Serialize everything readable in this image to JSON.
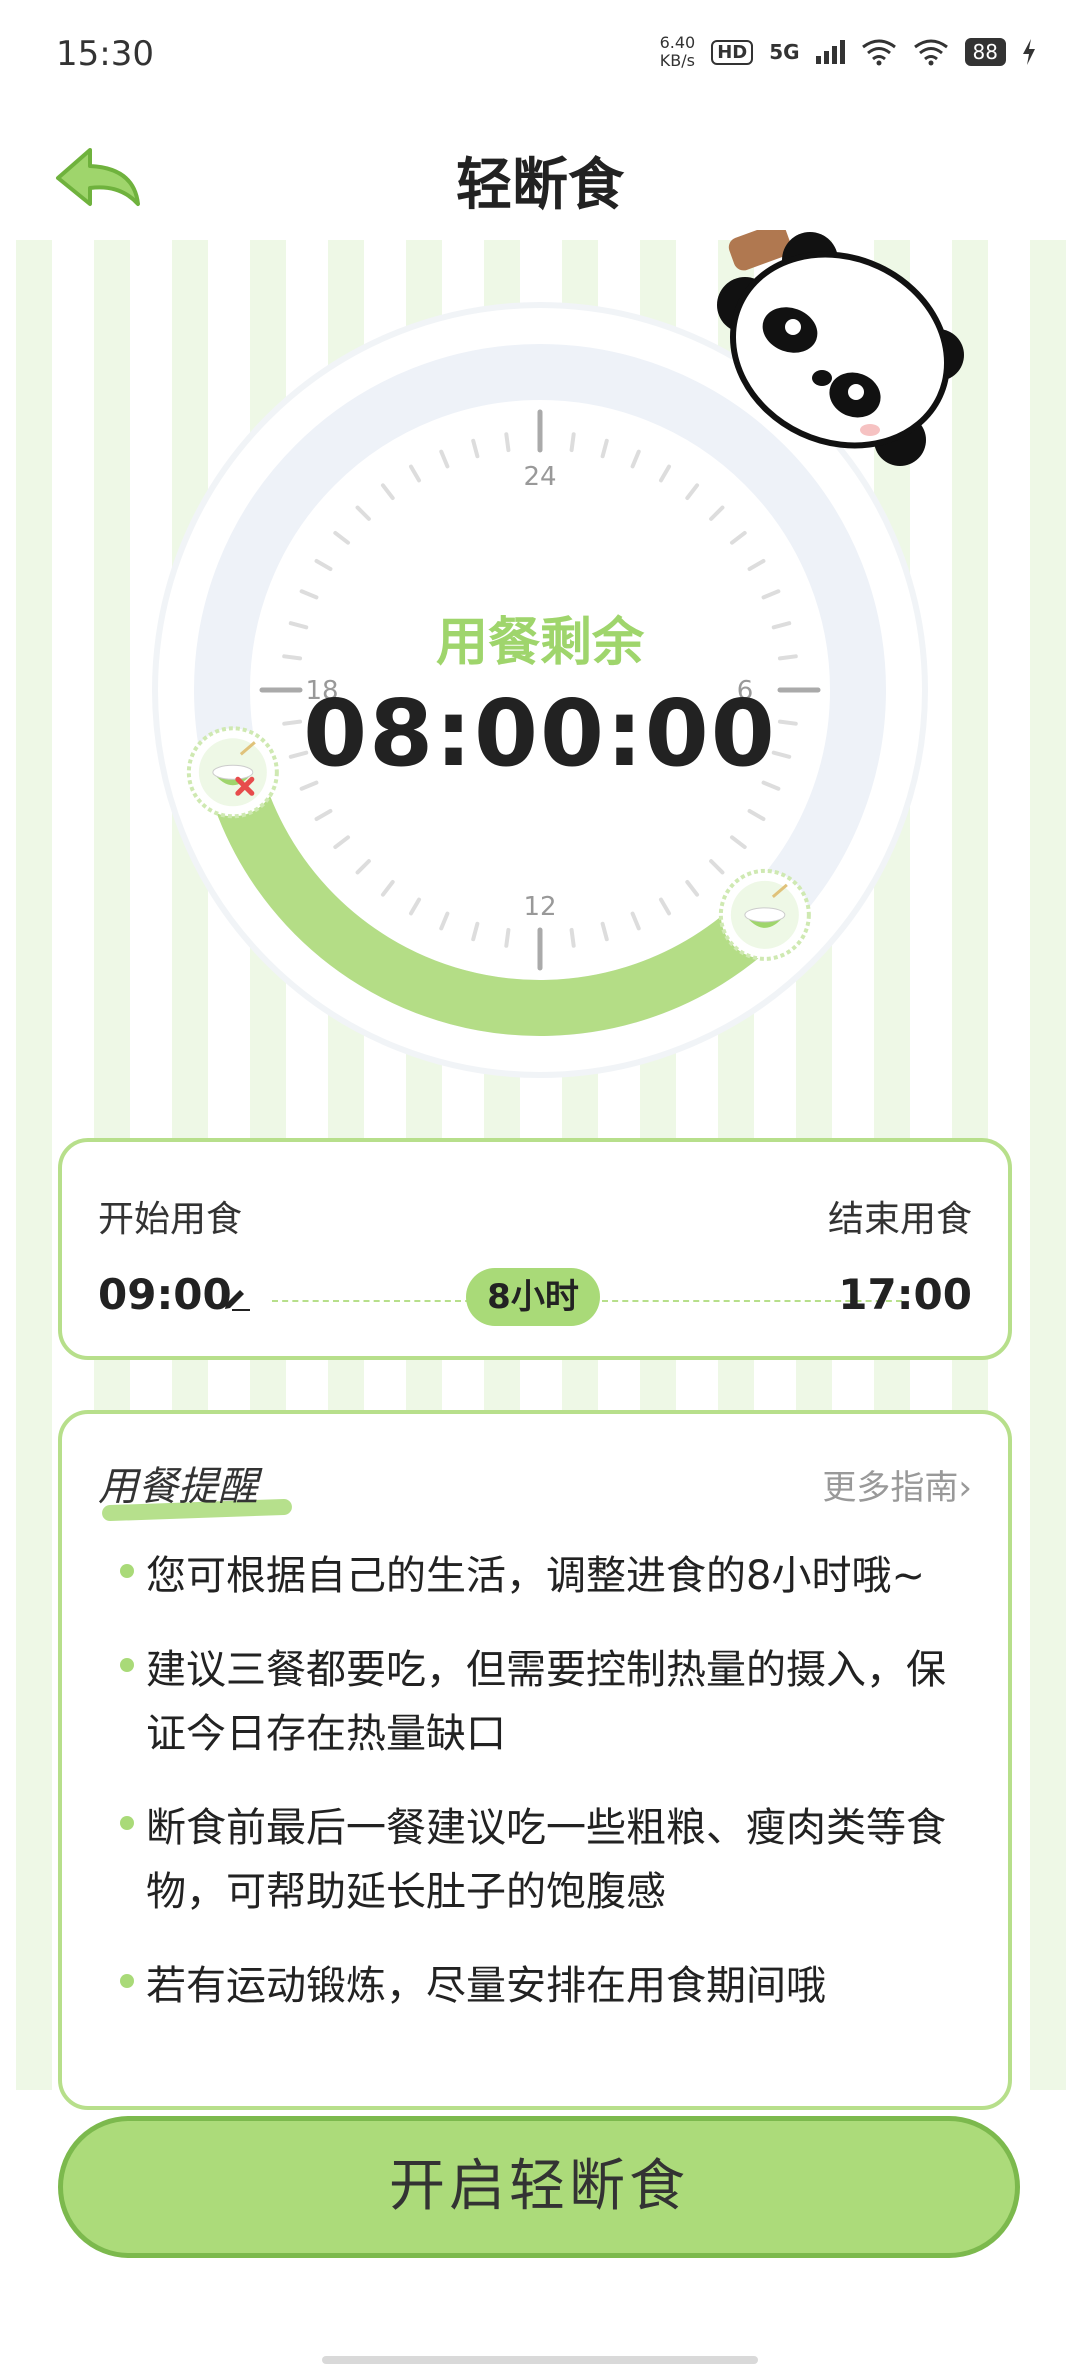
{
  "status_bar": {
    "time": "15:30",
    "net_speed_value": "6.40",
    "net_speed_unit": "KB/s",
    "hd_label": "HD",
    "network_type": "5G",
    "battery": "88"
  },
  "header": {
    "title": "轻断食",
    "back_icon": "back-arrow-icon"
  },
  "clock": {
    "label": "用餐剩余",
    "countdown": "08:00:00",
    "hour_labels": {
      "top": "24",
      "right": "6",
      "bottom": "12",
      "left": "18"
    },
    "eating_window_start_hour": 9,
    "eating_window_end_hour": 17,
    "colors": {
      "ring_track": "#eef2f8",
      "ring_active": "#b4dd86",
      "accent": "#9fd56c"
    }
  },
  "time_card": {
    "start_label": "开始用食",
    "end_label": "结束用食",
    "start_time": "09:00",
    "end_time": "17:00",
    "duration": "8小时"
  },
  "reminder": {
    "title": "用餐提醒",
    "more_link": "更多指南›",
    "tips": [
      "您可根据自己的生活，调整进食的8小时哦~",
      "建议三餐都要吃，但需要控制热量的摄入，保证今日存在热量缺口",
      "断食前最后一餐建议吃一些粗粮、瘦肉类等食物，可帮助延长肚子的饱腹感",
      "若有运动锻炼，尽量安排在用食期间哦"
    ]
  },
  "start_button": {
    "label": "开启轻断食"
  }
}
